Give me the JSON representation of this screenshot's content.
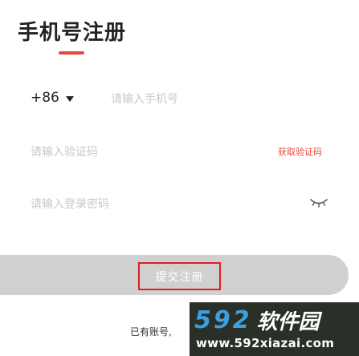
{
  "page": {
    "title": "手机号注册"
  },
  "colors": {
    "accent": "#e8483c",
    "button_disabled": "#d0d0d0",
    "placeholder": "#c8c8c8"
  },
  "form": {
    "country_code": "+86",
    "country_code_icon": "caret-down-icon",
    "phone_placeholder": "请输入手机号",
    "code_placeholder": "请输入验证码",
    "get_code_label": "获取验证码",
    "password_placeholder": "请输入登录密码",
    "password_toggle_icon": "eye-closed-icon",
    "submit_label": "提交注册"
  },
  "footer": {
    "has_account": "已有账号,"
  },
  "watermark": {
    "digits": "592",
    "brand": "软件园",
    "url": "www.592xiazai.com"
  }
}
